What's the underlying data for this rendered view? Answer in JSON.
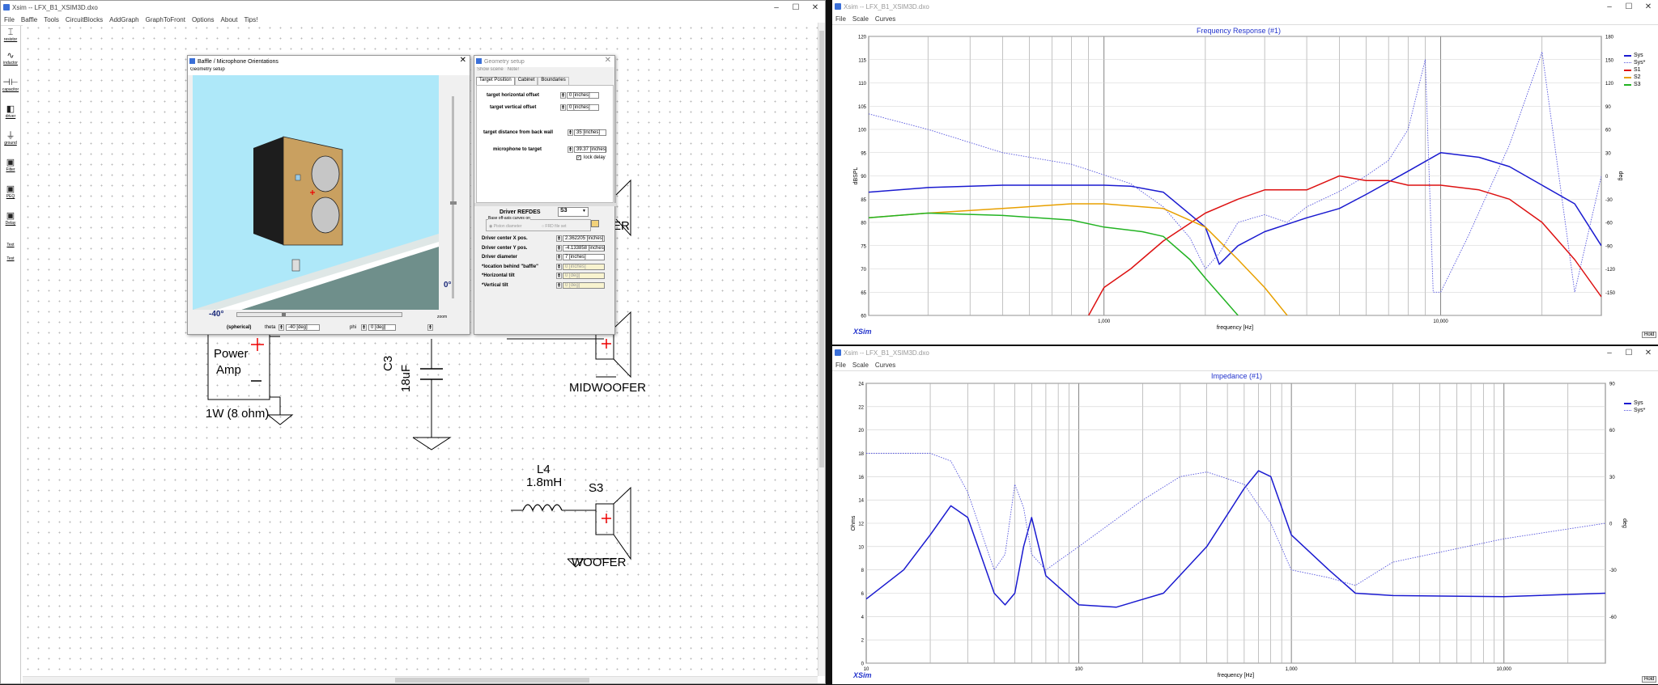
{
  "left_window": {
    "title": "Xsim -- LFX_B1_XSIM3D.dxo",
    "menu": [
      "File",
      "Baffle",
      "Tools",
      "CircuitBlocks",
      "AddGraph",
      "GraphToFront",
      "Options",
      "About",
      "Tips!"
    ],
    "controls": [
      "–",
      "☐",
      "✕"
    ],
    "tools": [
      {
        "icon": "resistor-icon",
        "glyph": "⌶",
        "label": "resistor"
      },
      {
        "icon": "inductor-icon",
        "glyph": "∿",
        "label": "inductor"
      },
      {
        "icon": "capacitor-icon",
        "glyph": "⊣⊢",
        "label": "capacitor"
      },
      {
        "icon": "driver-icon",
        "glyph": "◧",
        "label": "driver"
      },
      {
        "icon": "ground-icon",
        "glyph": "⏚",
        "label": "ground"
      },
      {
        "icon": "filter-icon",
        "glyph": "▣",
        "label": "Filter"
      },
      {
        "icon": "peq-icon",
        "glyph": "▣",
        "label": "PEQ"
      },
      {
        "icon": "delay-icon",
        "glyph": "▣",
        "label": "Delay"
      },
      {
        "icon": "text-icon",
        "glyph": "",
        "label": "Text"
      },
      {
        "icon": "test-icon",
        "glyph": "",
        "label": "Test"
      }
    ],
    "schematic": {
      "power_amp": "Power\nAmp",
      "power_amp_line1": "Power",
      "power_amp_line2": "Amp",
      "amp_rating": "1W (8 ohm)",
      "c3_name": "C3",
      "c3_value": "18uF",
      "midwoofer": "MIDWOOFER",
      "er_fragment": "ER",
      "l4_name": "L4",
      "l4_value": "1.8mH",
      "s3_name": "S3",
      "woofer": "WOOFER"
    }
  },
  "baffle_dialog": {
    "title": "Baffle / Microphone Orientations",
    "menu": "Geometry setup",
    "angle_bottom": "-40°",
    "angle_right": "0°",
    "zoom_label": "zoom",
    "spherical_label": "(spherical)",
    "theta_label": "theta",
    "theta_value": "-40 [deg]",
    "phi_label": "phi",
    "phi_value": "0 [deg]"
  },
  "geometry_dialog": {
    "title": "Geometry setup",
    "menu": [
      "Show scene",
      "Note!"
    ],
    "tabs": [
      "Target Position",
      "Cabinet",
      "Boundaries"
    ],
    "target_horizontal_label": "target horizontal offset",
    "target_horizontal_value": "0 [inches]",
    "target_vertical_label": "target vertical offset",
    "target_vertical_value": "0 [inches]",
    "target_distance_label": "target distance from back wall",
    "target_distance_value": "35 [inches]",
    "mic_to_target_label": "microphone to target",
    "mic_to_target_value": "39.37 [inches]",
    "lock_delay_label": "lock delay",
    "driver_refdes_label": "Driver REFDES",
    "driver_refdes_value": "S3",
    "base_offaxis_label": "Base off-axis curves on",
    "piston_label": "Piston diameter",
    "frd_label": "FRD file set",
    "fields": [
      {
        "label": "Driver center X pos.",
        "value": "2.362205 [inches]",
        "disabled": false
      },
      {
        "label": "Driver center Y pos.",
        "value": "-4.133858 [inches]",
        "disabled": false
      },
      {
        "label": "Driver diameter",
        "value": "7 [inches]",
        "disabled": false
      },
      {
        "label": "*location behind \"baffle\"",
        "value": "0 [inches]",
        "disabled": true
      },
      {
        "label": "*Horizontal tilt",
        "value": "0 [deg]",
        "disabled": true
      },
      {
        "label": "*Vertical tilt",
        "value": "0 [deg]",
        "disabled": true
      }
    ]
  },
  "freq_window": {
    "title": "Xsim -- LFX_B1_XSIM3D.dxo",
    "menu": [
      "File",
      "Scale",
      "Curves"
    ],
    "plot_title": "Frequency Response (#1)",
    "y_label": "dBSPL",
    "y2_label": "deg",
    "x_label": "frequency [Hz]",
    "brand": "XSim",
    "hold": "Hold"
  },
  "imp_window": {
    "title": "Xsim -- LFX_B1_XSIM3D.dxo",
    "menu": [
      "File",
      "Scale",
      "Curves"
    ],
    "plot_title": "Impedance (#1)",
    "y_label": "Ohms",
    "y2_label": "deg",
    "x_label": "frequency [Hz]",
    "brand": "XSim",
    "hold": "Hold"
  },
  "chart_data": [
    {
      "type": "line",
      "title": "Frequency Response (#1)",
      "xlabel": "frequency [Hz]",
      "ylabel": "dBSPL",
      "y2label": "deg",
      "xscale": "log",
      "xlim": [
        200,
        30000
      ],
      "ylim": [
        60,
        120
      ],
      "y2lim": [
        -180,
        180
      ],
      "xticks": [
        "1,000",
        "10,000"
      ],
      "yticks": [
        "60",
        "65",
        "70",
        "75",
        "80",
        "85",
        "90",
        "95",
        "100",
        "105",
        "110",
        "115",
        "120"
      ],
      "y2ticks": [
        "-150",
        "-120",
        "-90",
        "-60",
        "-30",
        "0",
        "30",
        "60",
        "90",
        "120",
        "150",
        "180"
      ],
      "legend_position": "top-right",
      "series": [
        {
          "name": "Sys",
          "color": "#1a1ad0",
          "style": "solid",
          "axis": "left",
          "x": [
            200,
            300,
            500,
            1000,
            1200,
            1500,
            2000,
            2200,
            2500,
            3000,
            4000,
            5000,
            6000,
            8000,
            10000,
            13000,
            16000,
            20000,
            25000,
            30000
          ],
          "y": [
            86.5,
            87.5,
            88,
            88,
            87.8,
            86.5,
            79,
            71,
            75,
            78,
            81,
            83,
            86,
            91,
            95,
            94,
            92,
            88,
            84,
            75
          ]
        },
        {
          "name": "Sys*",
          "color": "#5555dd",
          "style": "dotted",
          "axis": "right",
          "x": [
            200,
            300,
            500,
            800,
            1200,
            1500,
            1800,
            2000,
            2200,
            2500,
            3000,
            3500,
            4000,
            5000,
            6000,
            7000,
            8000,
            9000,
            9500,
            10000,
            12000,
            16000,
            20000,
            25000,
            30000
          ],
          "y": [
            80,
            60,
            30,
            15,
            -10,
            -40,
            -80,
            -120,
            -100,
            -60,
            -50,
            -60,
            -40,
            -20,
            0,
            20,
            60,
            150,
            -150,
            -150,
            -80,
            40,
            160,
            -150,
            0
          ]
        },
        {
          "name": "S1",
          "color": "#dd1111",
          "style": "solid",
          "axis": "left",
          "x": [
            900,
            1000,
            1200,
            1500,
            2000,
            2500,
            3000,
            4000,
            5000,
            6000,
            7000,
            8000,
            10000,
            13000,
            16000,
            20000,
            25000,
            30000
          ],
          "y": [
            60,
            66,
            70,
            76,
            82,
            85,
            87,
            87,
            90,
            89,
            89,
            88,
            88,
            87,
            85,
            80,
            72,
            64
          ]
        },
        {
          "name": "S2",
          "color": "#e8a000",
          "style": "solid",
          "axis": "left",
          "x": [
            200,
            300,
            500,
            800,
            1000,
            1500,
            2000,
            2500,
            3000,
            3500
          ],
          "y": [
            81,
            82,
            83,
            84,
            84,
            83,
            79,
            72,
            66,
            60
          ]
        },
        {
          "name": "S3",
          "color": "#22b322",
          "style": "solid",
          "axis": "left",
          "x": [
            200,
            300,
            500,
            800,
            1000,
            1300,
            1500,
            1800,
            2000,
            2300,
            2500
          ],
          "y": [
            81,
            82,
            81.5,
            80.5,
            79,
            78,
            77,
            72,
            68,
            63,
            60
          ]
        }
      ]
    },
    {
      "type": "line",
      "title": "Impedance (#1)",
      "xlabel": "frequency [Hz]",
      "ylabel": "Ohms",
      "y2label": "deg",
      "xscale": "log",
      "xlim": [
        10,
        30000
      ],
      "ylim": [
        0,
        24
      ],
      "y2lim": [
        -90,
        90
      ],
      "xticks": [
        "10",
        "100",
        "1,000",
        "10,000"
      ],
      "yticks": [
        "0",
        "2",
        "4",
        "6",
        "8",
        "10",
        "12",
        "14",
        "16",
        "18",
        "20",
        "22",
        "24"
      ],
      "y2ticks": [
        "-60",
        "-30",
        "0",
        "30",
        "60",
        "90"
      ],
      "legend_position": "top-right",
      "series": [
        {
          "name": "Sys",
          "color": "#1a1ad0",
          "style": "solid",
          "axis": "left",
          "x": [
            10,
            15,
            20,
            25,
            30,
            40,
            45,
            50,
            55,
            60,
            70,
            100,
            150,
            250,
            400,
            600,
            700,
            800,
            1000,
            1500,
            2000,
            3000,
            10000,
            30000
          ],
          "y": [
            5.5,
            8,
            11,
            13.5,
            12.5,
            6,
            5,
            6,
            10,
            12.5,
            7.5,
            5,
            4.8,
            6,
            10,
            15,
            16.5,
            16,
            11,
            8,
            6,
            5.8,
            5.7,
            6
          ]
        },
        {
          "name": "Sys*",
          "color": "#5555dd",
          "style": "dotted",
          "axis": "right",
          "x": [
            10,
            20,
            25,
            30,
            40,
            45,
            50,
            55,
            60,
            70,
            100,
            200,
            300,
            400,
            600,
            800,
            1000,
            1500,
            2000,
            3000,
            10000,
            30000
          ],
          "y": [
            45,
            45,
            40,
            20,
            -30,
            -20,
            25,
            10,
            -20,
            -30,
            -15,
            15,
            30,
            33,
            25,
            0,
            -30,
            -35,
            -40,
            -25,
            -10,
            0
          ]
        }
      ]
    }
  ]
}
